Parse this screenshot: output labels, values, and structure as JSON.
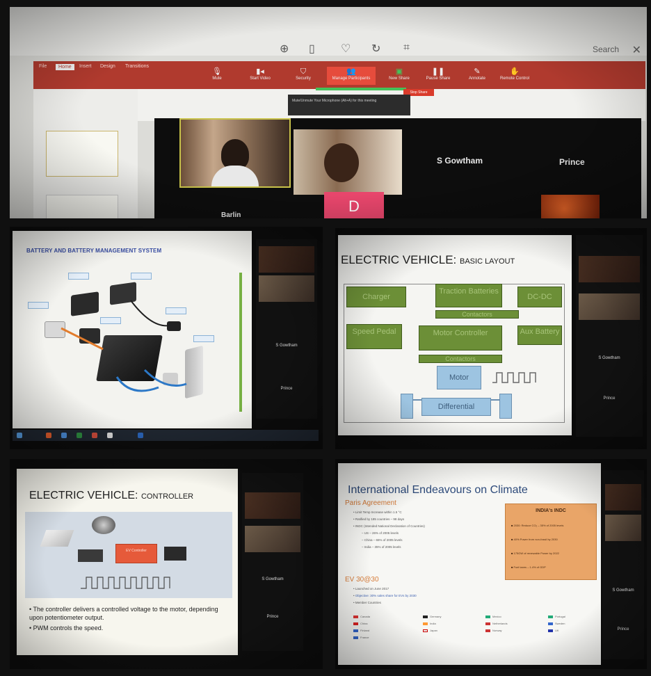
{
  "panel1": {
    "search_label": "Search",
    "zoom_controls": [
      {
        "label": "Mute",
        "icon": "mic-icon"
      },
      {
        "label": "Start Video",
        "icon": "video-icon"
      },
      {
        "label": "Security",
        "icon": "shield-icon"
      },
      {
        "label": "Manage Participants",
        "icon": "participants-icon"
      },
      {
        "label": "New Share",
        "icon": "share-icon"
      },
      {
        "label": "Pause Share",
        "icon": "pause-icon"
      },
      {
        "label": "Annotate",
        "icon": "pen-icon"
      },
      {
        "label": "Remote Control",
        "icon": "hand-icon"
      }
    ],
    "stop_share_label": "Stop Share",
    "tooltip": "Mute/Unmute Your Microphone (Alt+A) for this meeting",
    "participants": [
      {
        "name": "",
        "tile": "self-video"
      },
      {
        "name": "",
        "tile": "video"
      },
      {
        "name": "S Gowtham",
        "tile": "name"
      },
      {
        "name": "Prince",
        "tile": "name"
      },
      {
        "name": "Barlin",
        "tile": "name"
      },
      {
        "name": "D",
        "tile": "avatar"
      }
    ]
  },
  "panel2": {
    "slide_title": "BATTERY AND BATTERY MANAGEMENT SYSTEM",
    "side_names": [
      "S Gowtham",
      "Prince"
    ]
  },
  "panel3": {
    "title_main": "ELECTRIC VEHICLE:",
    "title_sub": "BASIC LAYOUT",
    "blocks": {
      "charger": "Charger",
      "traction": "Traction Batteries",
      "dcdc": "DC-DC",
      "contactors_top": "Contactors",
      "speed_pedal": "Speed Pedal",
      "motor_controller": "Motor Controller",
      "aux_battery": "Aux Battery",
      "contactors_bottom": "Contactors",
      "motor": "Motor",
      "differential": "Differential"
    },
    "side_names": [
      "S Gowtham",
      "Prince"
    ]
  },
  "panel4": {
    "title_main": "ELECTRIC VEHICLE:",
    "title_sub": "CONTROLLER",
    "controller_label": "EV Controller",
    "bullets": [
      "The controller delivers a controlled voltage to the motor, depending upon potentiometer output.",
      "PWM controls the speed."
    ],
    "side_names": [
      "S Gowtham",
      "Prince"
    ]
  },
  "panel5": {
    "title": "International Endeavours on Climate",
    "section1": "Paris Agreement",
    "section1_lines": [
      "Limit Temp Increase within 1.5 °C",
      "Ratified by 185 countries – 98 days",
      "INDC (Intended National Declaration of Countries)",
      "US – 26% of 2005 levels",
      "China – 65% of 2005 levels",
      "India – 35% of 2005 levels"
    ],
    "section2": "EV 30@30",
    "section2_lines": [
      "Launched on June 2017",
      "Objective: 30% sales share for EVs by 2030",
      "Member Countries"
    ],
    "india_box_title": "INDIA's INDC",
    "india_box_items": [
      "2030: Reduce CO₂ – 35% of 2005 levels",
      "40% Power from non-fossil by 2030",
      "175GW of renewable Power by 2022",
      "Fuel taxes – 1.4% of GDP"
    ],
    "countries": [
      "Canada",
      "China",
      "Finland",
      "France",
      "Germany",
      "India",
      "Japan",
      "Mexico",
      "Netherlands",
      "Norway",
      "Portugal",
      "Sweden",
      "UK"
    ],
    "side_names": [
      "S Gowtham",
      "Prince"
    ]
  }
}
